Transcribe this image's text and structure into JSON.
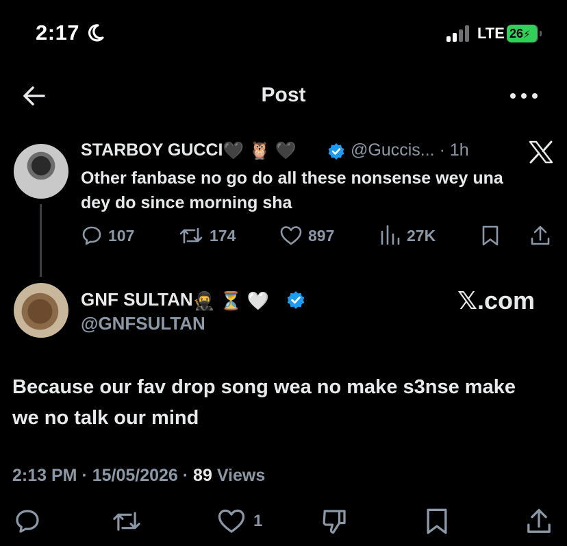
{
  "status_bar": {
    "time": "2:17",
    "network": "LTE",
    "battery": "26"
  },
  "header": {
    "title": "Post"
  },
  "quoted_tweet": {
    "name": "STARBOY GUCCI",
    "emojis": [
      "🖤",
      "🦉",
      "🖤"
    ],
    "handle": "@Guccis...",
    "time": "· 1h",
    "text": "Other fanbase no go do all these nonsense wey una dey do since morning sha",
    "replies": "107",
    "retweets": "174",
    "likes": "897",
    "views": "27K"
  },
  "tweet": {
    "name": "GNF SULTAN",
    "emojis": [
      "🥷",
      "⏳",
      "🤍"
    ],
    "handle": "@GNFSULTAN",
    "watermark": "𝕏.com",
    "text": "Because our fav drop song wea no make s3nse make we no talk our mind",
    "time": "2:13 PM",
    "date": "15/05/2026",
    "views_count": "89",
    "views_label": "Views",
    "likes": "1"
  },
  "colors": {
    "background": "#000000",
    "text": "#e7e9ea",
    "secondary": "#8b98a5",
    "verified": "#1d9bf0",
    "battery": "#30d158"
  }
}
